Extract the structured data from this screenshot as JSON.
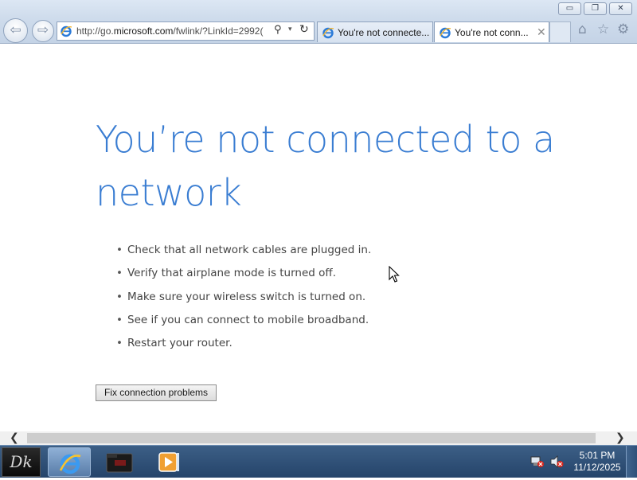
{
  "window": {
    "minimize_glyph": "▭",
    "maximize_glyph": "❐",
    "close_glyph": "✕"
  },
  "navigation": {
    "back_glyph": "⇦",
    "forward_glyph": "⇨",
    "address": {
      "url_prefix": "http://go.",
      "url_domain": "microsoft.com",
      "url_rest": "/fwlink/?LinkId=2992(",
      "search_glyph": "⚲",
      "dropdown_glyph": "▾",
      "refresh_glyph": "↻"
    }
  },
  "tabs": [
    {
      "label": "You're not connecte...",
      "icon": "ie-icon",
      "active": false
    },
    {
      "label": "You're not conn...",
      "icon": "ie-icon",
      "active": true,
      "close_glyph": "✕"
    }
  ],
  "command_icons": {
    "home": "⌂",
    "favorites": "☆",
    "tools": "⚙"
  },
  "page": {
    "title": "You’re not connected to a network",
    "bullet_glyph": "•",
    "tips": [
      "Check that all network cables are plugged in.",
      "Verify that airplane mode is turned off.",
      "Make sure your wireless switch is turned on.",
      "See if you can connect to mobile broadband.",
      "Restart your router."
    ],
    "fix_button_label": "Fix connection problems",
    "title_color": "#3a7dd2"
  },
  "scrollbar": {
    "left_glyph": "❮",
    "right_glyph": "❯"
  },
  "taskbar": {
    "start_label": "Dk",
    "pinned_apps": [
      "internet-explorer",
      "dark-folder-app",
      "media-player"
    ],
    "clock_time": "5:01 PM",
    "clock_date": "11/12/2025",
    "tray_icons": [
      "network-disconnected-icon",
      "volume-muted-icon"
    ]
  }
}
